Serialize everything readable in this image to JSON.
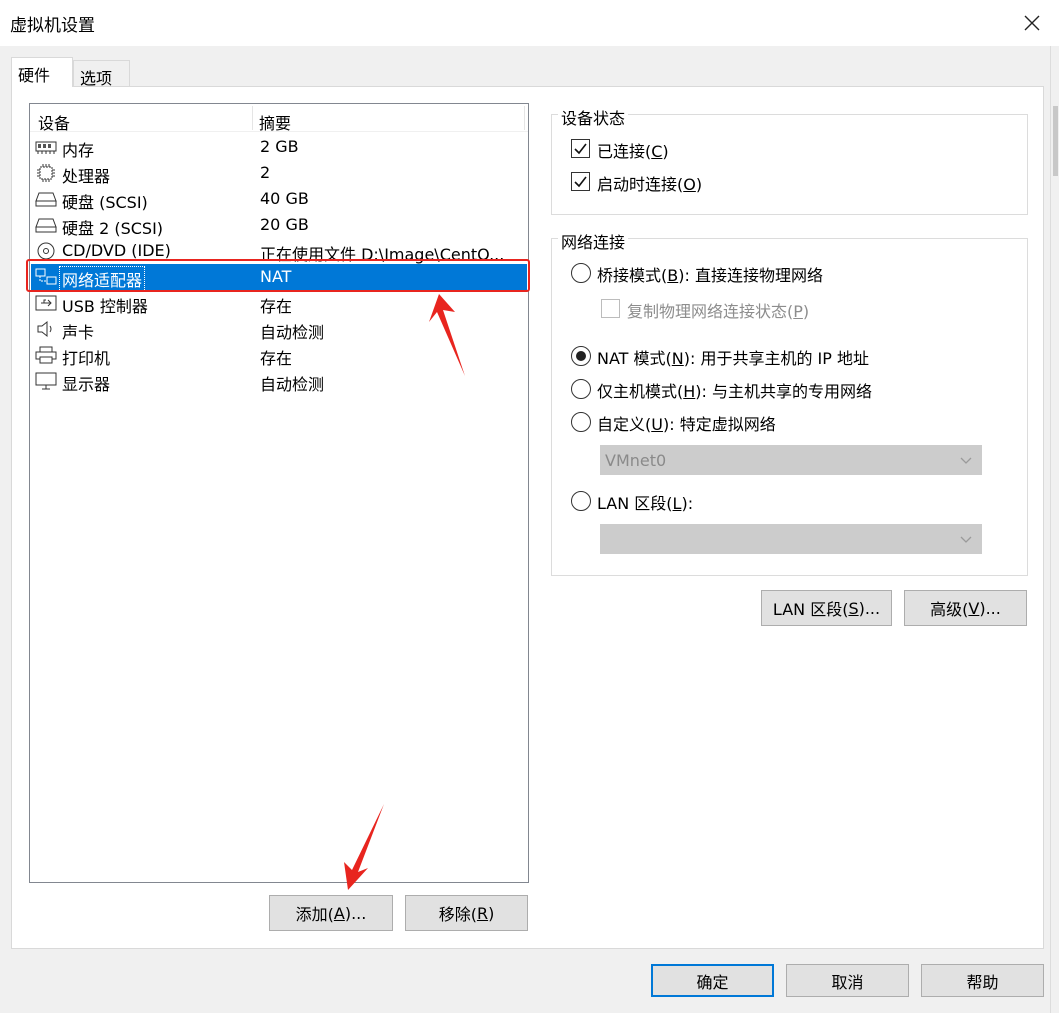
{
  "window": {
    "title": "虚拟机设置"
  },
  "tabs": [
    {
      "label": "硬件"
    },
    {
      "label": "选项"
    }
  ],
  "device_list": {
    "columns": [
      "设备",
      "摘要"
    ],
    "rows": [
      {
        "name": "内存",
        "summary": "2 GB",
        "icon": "memory-icon"
      },
      {
        "name": "处理器",
        "summary": "2",
        "icon": "processor-icon"
      },
      {
        "name": "硬盘 (SCSI)",
        "summary": "40 GB",
        "icon": "hard-disk-icon"
      },
      {
        "name": "硬盘 2 (SCSI)",
        "summary": "20 GB",
        "icon": "hard-disk-icon"
      },
      {
        "name": "CD/DVD (IDE)",
        "summary": "正在使用文件 D:\\Image\\CentO...",
        "icon": "cd-dvd-icon"
      },
      {
        "name": "网络适配器",
        "summary": "NAT",
        "icon": "network-adapter-icon",
        "selected": true
      },
      {
        "name": "USB 控制器",
        "summary": "存在",
        "icon": "usb-icon"
      },
      {
        "name": "声卡",
        "summary": "自动检测",
        "icon": "speaker-icon"
      },
      {
        "name": "打印机",
        "summary": "存在",
        "icon": "printer-icon"
      },
      {
        "name": "显示器",
        "summary": "自动检测",
        "icon": "monitor-icon"
      }
    ]
  },
  "list_buttons": {
    "add": "添加(A)...",
    "add_pre": "添加(",
    "add_key": "A",
    "add_post": ")...",
    "remove_pre": "移除(",
    "remove_key": "R",
    "remove_post": ")"
  },
  "device_status": {
    "title": "设备状态",
    "connected": {
      "pre": "已连接(",
      "key": "C",
      "post": ")",
      "checked": true
    },
    "connect_on_power": {
      "pre": "启动时连接(",
      "key": "O",
      "post": ")",
      "checked": true
    }
  },
  "network": {
    "title": "网络连接",
    "bridged": {
      "pre": "桥接模式(",
      "key": "B",
      "post": "): 直接连接物理网络",
      "selected": false
    },
    "replicate": {
      "pre": "复制物理网络连接状态(",
      "key": "P",
      "post": ")",
      "checked": false,
      "disabled": true
    },
    "nat": {
      "pre": "NAT 模式(",
      "key": "N",
      "post": "): 用于共享主机的 IP 地址",
      "selected": true
    },
    "host_only": {
      "pre": "仅主机模式(",
      "key": "H",
      "post": "): 与主机共享的专用网络",
      "selected": false
    },
    "custom": {
      "pre": "自定义(",
      "key": "U",
      "post": "): 特定虚拟网络",
      "selected": false
    },
    "vmnet_select": {
      "value": "VMnet0"
    },
    "lan": {
      "pre": "LAN 区段(",
      "key": "L",
      "post": "):",
      "selected": false
    },
    "lan_select": {
      "value": ""
    }
  },
  "side_buttons": {
    "lan_segments": {
      "pre": "LAN 区段(",
      "key": "S",
      "post": ")..."
    },
    "advanced": {
      "pre": "高级(",
      "key": "V",
      "post": ")..."
    }
  },
  "footer": {
    "ok": "确定",
    "cancel": "取消",
    "help": "帮助"
  },
  "colors": {
    "selection": "#0078d7",
    "annotation_red": "#e8251f",
    "dialog_bg": "#f0f0f0"
  }
}
